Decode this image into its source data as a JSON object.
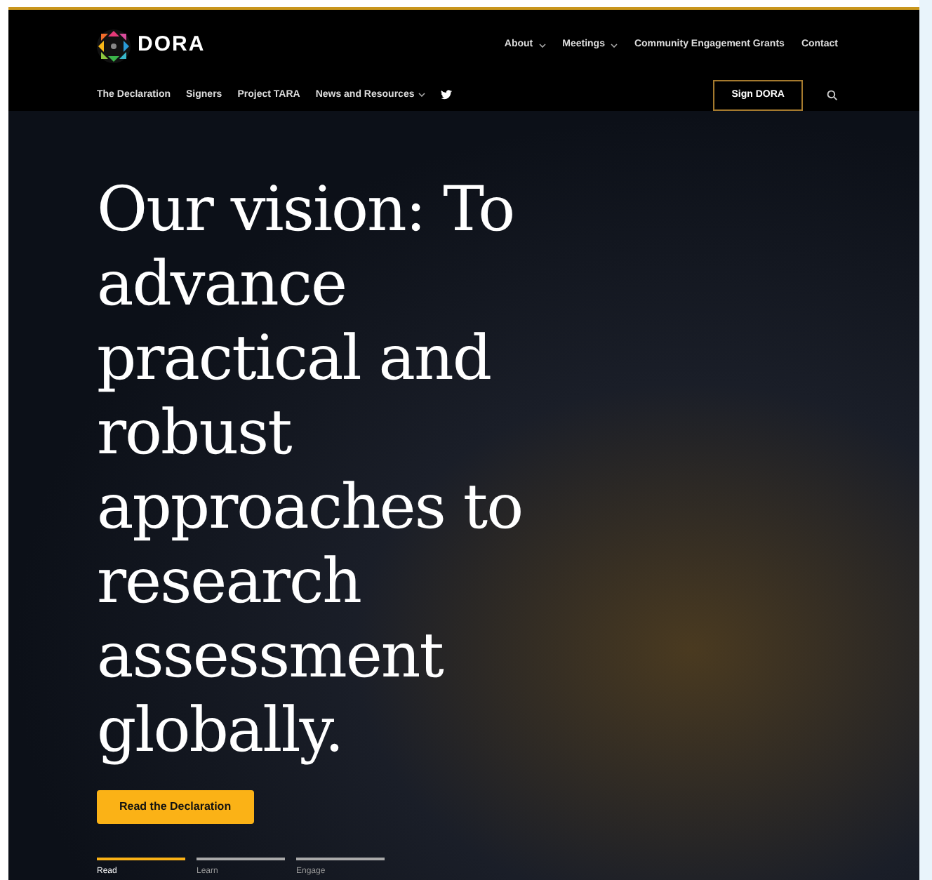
{
  "logo": {
    "text": "DORA"
  },
  "top_nav": [
    {
      "label": "About",
      "dropdown": true
    },
    {
      "label": "Meetings",
      "dropdown": true
    },
    {
      "label": "Community Engagement Grants",
      "dropdown": false
    },
    {
      "label": "Contact",
      "dropdown": false
    }
  ],
  "main_nav": [
    {
      "label": "The Declaration",
      "dropdown": false
    },
    {
      "label": "Signers",
      "dropdown": false
    },
    {
      "label": "Project TARA",
      "dropdown": false
    },
    {
      "label": "News and Resources",
      "dropdown": true
    }
  ],
  "sign_button": "Sign DORA",
  "hero": {
    "headline": "Our vision: To advance practical and robust approaches to research assessment globally.",
    "button": "Read the Declaration"
  },
  "steps": [
    {
      "label": "Read",
      "selected": true
    },
    {
      "label": "Learn",
      "selected": false
    },
    {
      "label": "Engage",
      "selected": false
    }
  ]
}
